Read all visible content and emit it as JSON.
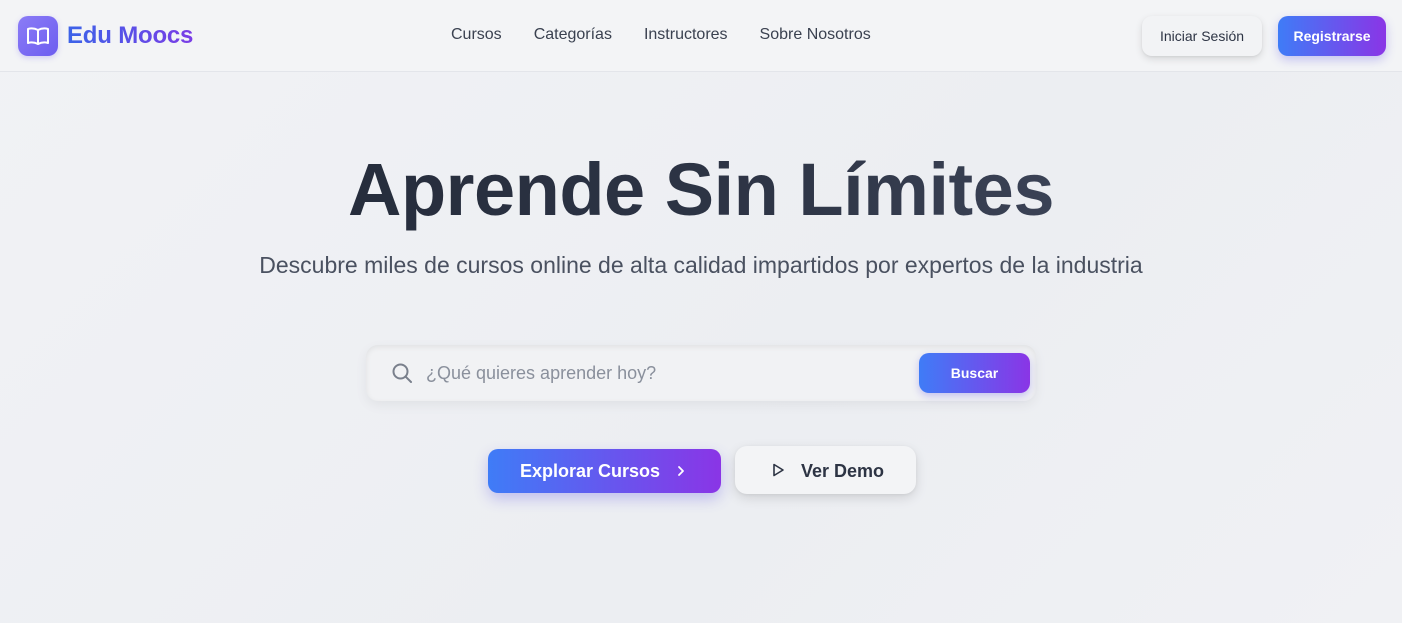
{
  "brand": {
    "name": "Edu Moocs",
    "logo_icon": "open-book-icon"
  },
  "nav": {
    "links": [
      "Cursos",
      "Categorías",
      "Instructores",
      "Sobre Nosotros"
    ],
    "login_label": "Iniciar Sesión",
    "register_label": "Registrarse"
  },
  "hero": {
    "title": "Aprende Sin Límites",
    "subtitle": "Descubre miles de cursos online de alta calidad impartidos por expertos de la industria"
  },
  "search": {
    "icon": "search-icon",
    "placeholder": "¿Qué quieres aprender hoy?",
    "value": "",
    "button_label": "Buscar"
  },
  "cta": {
    "explore_label": "Explorar Cursos",
    "explore_icon": "chevron-right-icon",
    "demo_label": "Ver Demo",
    "demo_icon": "play-icon"
  },
  "colors": {
    "gradient_start": "#3f7cf7",
    "gradient_end": "#8a35e6",
    "text_dark": "#2d3444",
    "background": "#eef0f3"
  }
}
